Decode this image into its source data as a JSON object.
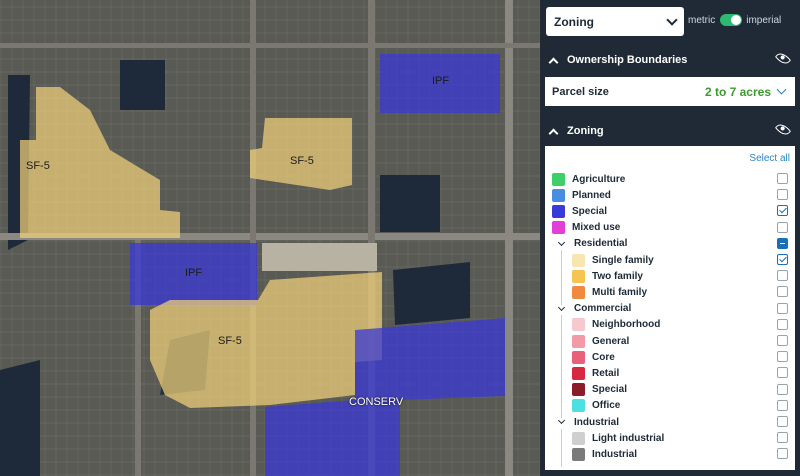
{
  "map": {
    "zones": [
      {
        "code": "IPF",
        "color": "#3a3ad6"
      },
      {
        "code": "SF-5",
        "color": "#f5d47a"
      },
      {
        "code": "SF-5",
        "color": "#f5d47a"
      },
      {
        "code": "IPF",
        "color": "#3a3ad6"
      },
      {
        "code": "SF-5",
        "color": "#f5d47a"
      },
      {
        "code": "CONSERV",
        "color": "#3a3ad6"
      }
    ]
  },
  "top_bar": {
    "layer_select": "Zoning",
    "unit_metric": "metric",
    "unit_imperial": "imperial",
    "unit_selected": "imperial"
  },
  "ownership": {
    "title": "Ownership Boundaries",
    "parcel_label": "Parcel size",
    "parcel_value": "2 to 7 acres"
  },
  "zoning": {
    "title": "Zoning",
    "select_all": "Select all",
    "items": [
      {
        "label": "Agriculture",
        "color": "#3fcf6a",
        "state": "unchecked"
      },
      {
        "label": "Planned",
        "color": "#4a8de0",
        "state": "unchecked"
      },
      {
        "label": "Special",
        "color": "#3a3ad6",
        "state": "checked"
      },
      {
        "label": "Mixed use",
        "color": "#e040d8",
        "state": "unchecked"
      }
    ],
    "groups": [
      {
        "label": "Residential",
        "state": "partial",
        "items": [
          {
            "label": "Single family",
            "color": "#f8e6b0",
            "state": "checked"
          },
          {
            "label": "Two family",
            "color": "#f5c451",
            "state": "unchecked"
          },
          {
            "label": "Multi family",
            "color": "#f08a3c",
            "state": "unchecked"
          }
        ]
      },
      {
        "label": "Commercial",
        "state": "unchecked",
        "items": [
          {
            "label": "Neighborhood",
            "color": "#f7c9cf",
            "state": "unchecked"
          },
          {
            "label": "General",
            "color": "#f29aa6",
            "state": "unchecked"
          },
          {
            "label": "Core",
            "color": "#e8607a",
            "state": "unchecked"
          },
          {
            "label": "Retail",
            "color": "#d6283f",
            "state": "unchecked"
          },
          {
            "label": "Special",
            "color": "#8c1b2a",
            "state": "unchecked"
          },
          {
            "label": "Office",
            "color": "#4de0e0",
            "state": "unchecked"
          }
        ]
      },
      {
        "label": "Industrial",
        "state": "unchecked",
        "items": [
          {
            "label": "Light industrial",
            "color": "#cfcfcf",
            "state": "unchecked"
          },
          {
            "label": "Industrial",
            "color": "#7a7a7a",
            "state": "unchecked"
          }
        ]
      }
    ]
  }
}
